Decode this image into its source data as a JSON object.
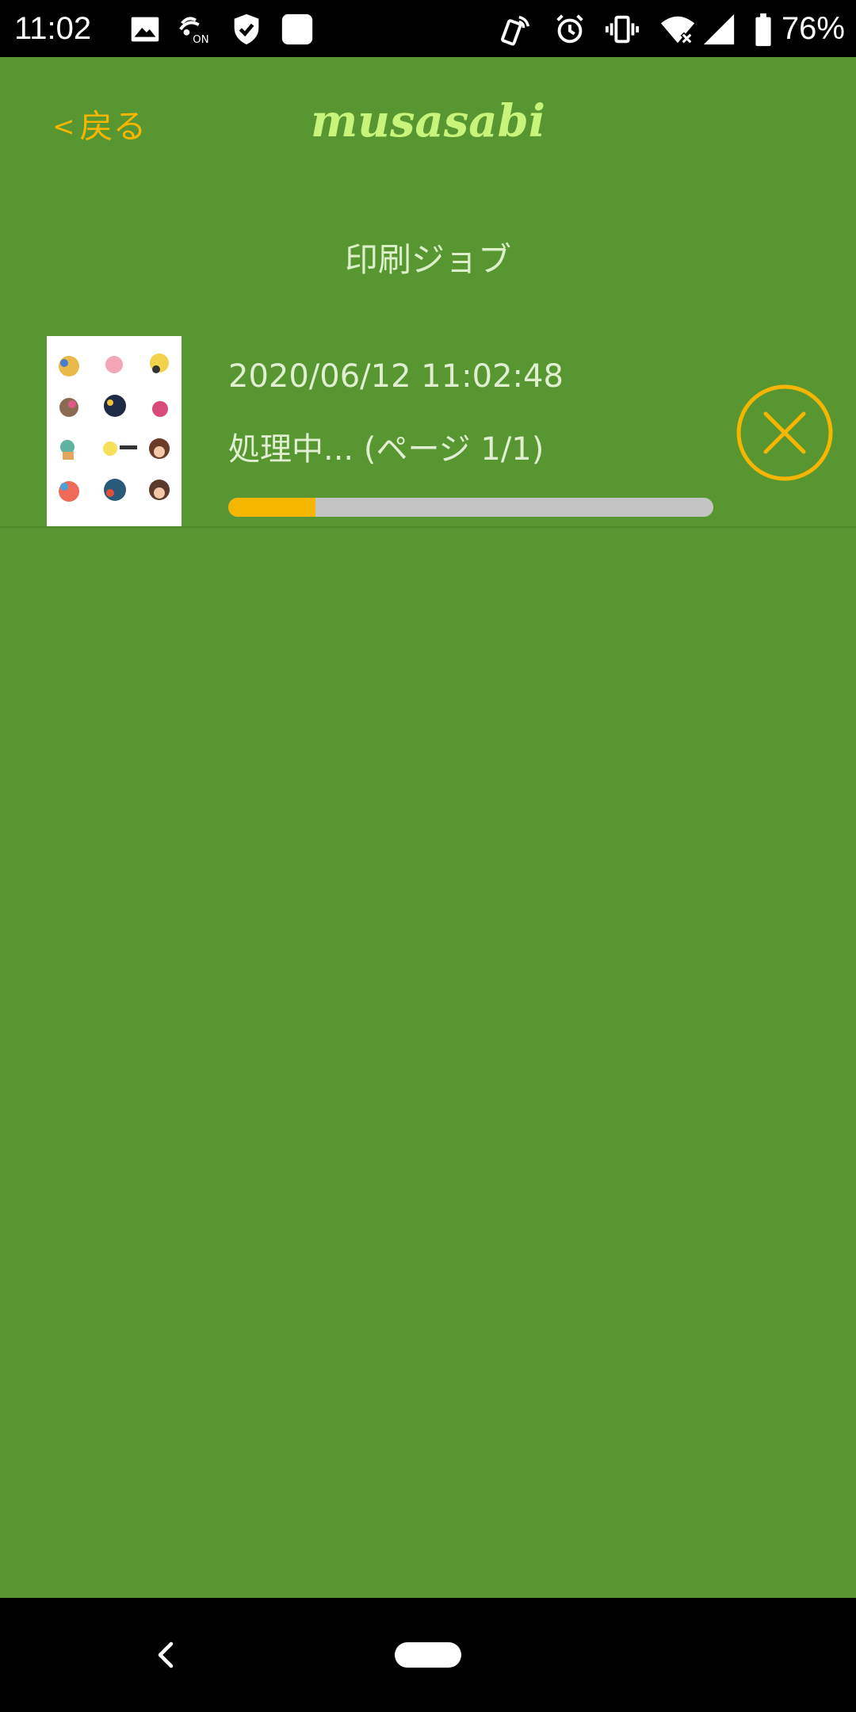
{
  "status_bar": {
    "time": "11:02",
    "battery": "76%",
    "icons": [
      "gallery-icon",
      "nfc-on-icon",
      "shield-check-icon",
      "app-square-icon",
      "phone-tap-icon",
      "alarm-icon",
      "vibrate-icon",
      "wifi-off-icon",
      "signal-icon",
      "battery-icon"
    ]
  },
  "header": {
    "back_label": "戻る",
    "back_chevron": "<",
    "logo": "musasabi"
  },
  "page": {
    "title": "印刷ジョブ"
  },
  "job": {
    "datetime": "2020/06/12 11:02:48",
    "status": "処理中... (ページ 1/1)",
    "progress": 0.18
  },
  "colors": {
    "background": "#589632",
    "accent": "#f6b600",
    "logo": "#c8f47c",
    "progress_track": "#c4c4c4"
  },
  "nav": {
    "icons": [
      "back-icon",
      "home-pill-icon"
    ]
  }
}
